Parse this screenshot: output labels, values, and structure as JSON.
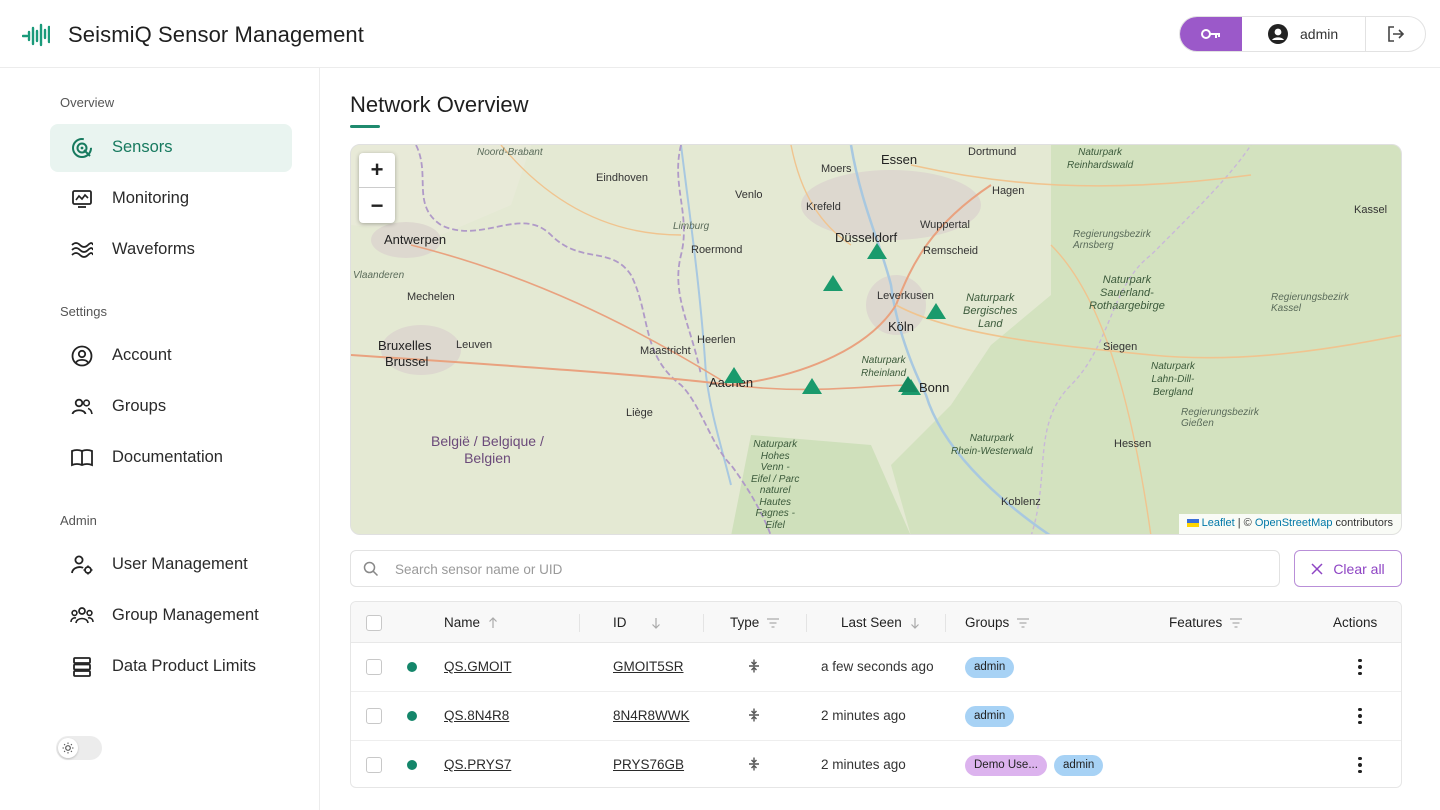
{
  "app": {
    "title": "SeismiQ Sensor Management"
  },
  "header": {
    "user": "admin"
  },
  "sidebar": {
    "sections": [
      {
        "label": "Overview",
        "items": [
          {
            "label": "Sensors",
            "icon": "sensor-radar-icon",
            "active": true
          },
          {
            "label": "Monitoring",
            "icon": "monitor-chart-icon"
          },
          {
            "label": "Waveforms",
            "icon": "waveform-icon"
          }
        ]
      },
      {
        "label": "Settings",
        "items": [
          {
            "label": "Account",
            "icon": "account-circle-icon"
          },
          {
            "label": "Groups",
            "icon": "groups-icon"
          },
          {
            "label": "Documentation",
            "icon": "book-icon"
          }
        ]
      },
      {
        "label": "Admin",
        "items": [
          {
            "label": "User Management",
            "icon": "user-gear-icon"
          },
          {
            "label": "Group Management",
            "icon": "group-management-icon"
          },
          {
            "label": "Data Product Limits",
            "icon": "database-icon"
          }
        ]
      }
    ]
  },
  "page": {
    "title": "Network Overview"
  },
  "map": {
    "zoom_in": "+",
    "zoom_out": "−",
    "labels": {
      "essen": "Essen",
      "dortmund": "Dortmund",
      "noord_brabant": "Noord-Brabant",
      "eindhoven": "Eindhoven",
      "moers": "Moers",
      "venlo": "Venlo",
      "hagen": "Hagen",
      "krefeld": "Krefeld",
      "wuppertal": "Wuppertal",
      "antwerpen": "Antwerpen",
      "limburg": "Limburg",
      "roermond": "Roermond",
      "dusseldorf": "Düsseldorf",
      "remscheid": "Remscheid",
      "vlaanderen": "Vlaanderen",
      "mechelen": "Mechelen",
      "leverkusen": "Leverkusen",
      "koln": "Köln",
      "bruxelles": "Bruxelles",
      "brussel": "Brussel",
      "leuven": "Leuven",
      "heerlen": "Heerlen",
      "maastricht": "Maastricht",
      "aachen": "Aachen",
      "bonn": "Bonn",
      "liege": "Liège",
      "siegen": "Siegen",
      "kassel": "Kassel",
      "koblenz": "Koblenz",
      "hessen": "Hessen",
      "belgique_1": "België / Belgique /",
      "belgique_2": "Belgien",
      "park_bergisches": "Naturpark\nBergisches\nLand",
      "park_sauerland": "Naturpark\nSauerland-\nRothaargebirge",
      "park_rheinland": "Naturpark\nRheinland",
      "park_eifel": "Naturpark\nHohes\nVenn -\nEifel / Parc\nnaturel\nHautes\nFagnes -\nEifel",
      "park_rhein_westerwald": "Naturpark\nRhein-Westerwald",
      "park_lahn": "Naturpark\nLahn-Dill-\nBergland",
      "park_reinhardswald": "Naturpark\nReinhardswald",
      "reg_arnsberg": "Regierungsbezirk\nArnsberg",
      "reg_kassel": "Regierungsbezirk\nKassel",
      "reg_giessen": "Regierungsbezirk\nGießen",
      "reg_kassel_top": "Naturpark\nReinhardswald"
    },
    "attribution": {
      "leaflet": "Leaflet",
      "sep": " | © ",
      "osm": "OpenStreetMap",
      "tail": " contributors"
    },
    "sensor_count": 7
  },
  "search": {
    "placeholder": "Search sensor name or UID",
    "value": ""
  },
  "clear_button": "Clear all",
  "table": {
    "columns": [
      "Name",
      "ID",
      "Type",
      "Last Seen",
      "Groups",
      "Features",
      "Actions"
    ],
    "rows": [
      {
        "name": "QS.GMOIT",
        "id": "GMOIT5SR",
        "type_icon": "type-arrows-icon",
        "last_seen": "a few seconds ago",
        "groups": [
          "admin"
        ],
        "status": "online"
      },
      {
        "name": "QS.8N4R8",
        "id": "8N4R8WWK",
        "type_icon": "type-arrows-icon",
        "last_seen": "2 minutes ago",
        "groups": [
          "admin"
        ],
        "status": "online"
      },
      {
        "name": "QS.PRYS7",
        "id": "PRYS76GB",
        "type_icon": "type-arrows-icon",
        "last_seen": "2 minutes ago",
        "groups": [
          "Demo Use...",
          "admin"
        ],
        "status": "online"
      }
    ]
  },
  "colors": {
    "accent": "#1f8a6e",
    "brand_purple": "#9b59c9",
    "status_online": "#14866a",
    "badge_admin": "#a7d2f5",
    "badge_demo": "#dcb3ee"
  }
}
